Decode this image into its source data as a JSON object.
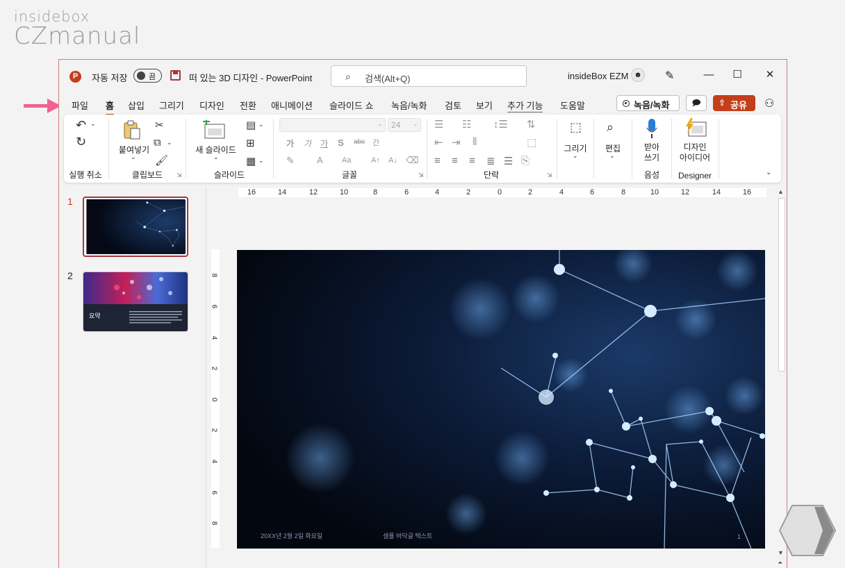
{
  "watermark": {
    "line1": "insidebox",
    "line2": "CZmanual"
  },
  "titlebar": {
    "app_icon": "P",
    "autosave_label": "자동 저장",
    "autosave_state": "끔",
    "document_title": "떠 있는 3D 디자인  -  PowerPoint",
    "search_placeholder": "검색(Alt+Q)",
    "user_name": "insideBox EZM",
    "minimize": "—",
    "maximize": "☐",
    "close": "✕"
  },
  "tabs": [
    "파일",
    "홈",
    "삽입",
    "그리기",
    "디자인",
    "전환",
    "애니메이션",
    "슬라이드 쇼",
    "녹음/녹화",
    "검토",
    "보기",
    "추가 기능",
    "도움말"
  ],
  "actions": {
    "record": "녹음/녹화",
    "comments": "🗩",
    "share": "공유"
  },
  "ribbon": {
    "undo_group": "실행 취소",
    "clipboard_group": "클립보드",
    "paste": "붙여넣기",
    "slides_group": "슬라이드",
    "new_slide": "새 슬라이드",
    "font_group": "글꼴",
    "font_size": "24",
    "font_buttons": [
      "가",
      "가",
      "가",
      "S",
      "abc",
      "간"
    ],
    "paragraph_group": "단락",
    "draw": "그리기",
    "edit": "편집",
    "dictate": "받아\n쓰기",
    "voice_group": "음성",
    "design_ideas": "디자인\n아이디어",
    "designer_group": "Designer"
  },
  "slides_panel": {
    "items": [
      {
        "number": "1",
        "selected": true
      },
      {
        "number": "2",
        "title": "요약",
        "selected": false
      }
    ]
  },
  "ruler": {
    "horizontal": [
      "16",
      "14",
      "12",
      "10",
      "8",
      "6",
      "4",
      "2",
      "0",
      "2",
      "4",
      "6",
      "8",
      "10",
      "12",
      "14",
      "16"
    ],
    "vertical": [
      "8",
      "6",
      "4",
      "2",
      "0",
      "2",
      "4",
      "6",
      "8"
    ]
  },
  "slide": {
    "date": "20XX년 2월 2일 화요일",
    "footer_text": "샘플 바닥글 텍스트",
    "page_number": "1"
  },
  "colors": {
    "accent": "#c43e1c",
    "selected_border": "#a4373a",
    "arrow": "#f06292",
    "slide_bg": "#050a16"
  }
}
